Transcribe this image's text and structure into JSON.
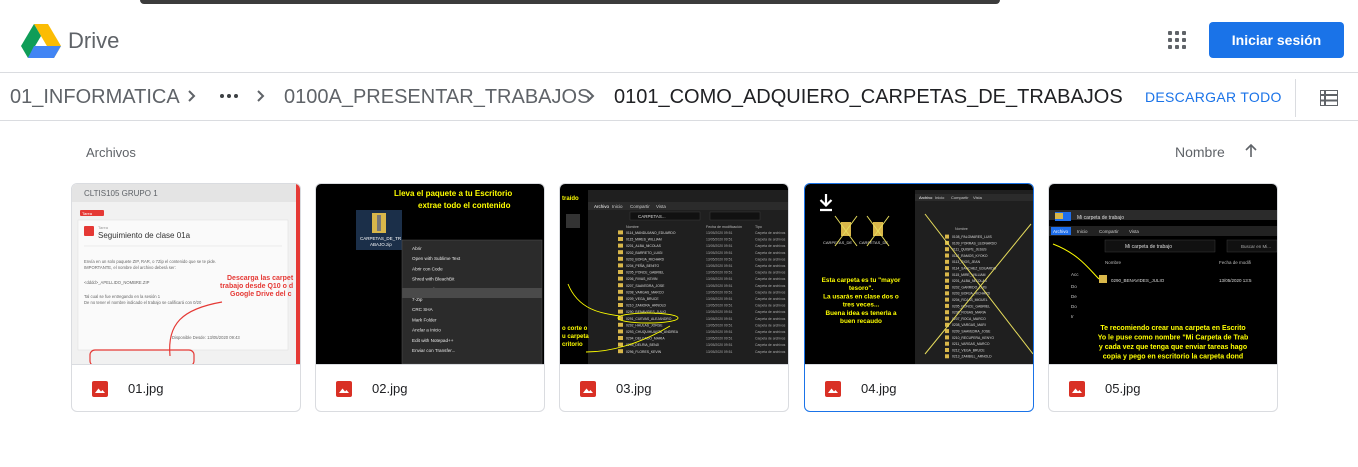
{
  "app": {
    "name": "Drive",
    "signin_label": "Iniciar sesión"
  },
  "breadcrumb": {
    "items": [
      "01_INFORMATICA",
      "0100A_PRESENTAR_TRABAJOS",
      "0101_COMO_ADQUIERO_CARPETAS_DE_TRABAJOS"
    ],
    "download_all": "DESCARGAR TODO"
  },
  "files_section": {
    "label": "Archivos",
    "sort_label": "Nombre"
  },
  "colors": {
    "accent": "#1a73e8",
    "image_icon": "#d93025",
    "annotation_yellow": "#ffff00",
    "annotation_red": "#ff0000"
  },
  "files": [
    {
      "name": "01.jpg",
      "selected": false,
      "thumb": {
        "group": "CLTIS105 GRUPO 1",
        "tag": "Tarea",
        "kind": "Tarea",
        "title": "Seguimiento de clase 01a",
        "body1": "Envía en un solo paquete ZIP, RAR, o 7Zip el contenido que se te pide.",
        "body2": "IMPORTANTE, el nombre del archivo deberá ser:",
        "body3": "<dddd>_APELLIDO_NOMBRE.ZIP",
        "body4": "Tal cual se fue entregando en la sesión 1",
        "body5": "De no tener el nombre indicado el trabajo se calificará con 0/20",
        "available": "Disponible Desde:  13/05/2020 09:43",
        "note1": "Descarga las carpet",
        "note2": "trabajo desde Q10 o d",
        "note3": "Google Drive del c"
      }
    },
    {
      "name": "02.jpg",
      "selected": false,
      "thumb": {
        "line1": "Lleva el paquete a tu Escritorio",
        "line2": "extrae todo el contenido",
        "file_label1": "CARPETAS_DE_TR",
        "file_label2": "ABAJO.zip",
        "menu": [
          "Abrir",
          "Open with Sublime Text",
          "Abrir con Code",
          "Shred with BleachBit",
          "Extraer todo...",
          "7-Zip",
          "CRC SHA",
          "Mark Folder",
          "Anclar a Inicio",
          "Edit with Notepad++",
          "Enviar con Transfer..."
        ]
      }
    },
    {
      "name": "03.jpg",
      "selected": false,
      "thumb": {
        "tabs": [
          "Archivo",
          "Inicio",
          "Compartir",
          "Vista"
        ],
        "path": "CARPETAS...",
        "col_name": "Nombre",
        "col_date": "Fecha de modificación",
        "col_type": "Tipo",
        "left_note": "traído",
        "bottom_note1": "o corte o",
        "bottom_note2": "u carpeta",
        "bottom_note3": "critorio",
        "rows": [
          "0114_MANDUJANO_EDUARDO",
          "0115_MIRES_WILLIAM",
          "0201_ALBA_NICOLAS",
          "0202_BARRETO_LUIGI",
          "0203_BORJA_RICHARD",
          "0204_PEÑA_BENITO",
          "0205_PONCE_GABRIEL",
          "0206_RIVAS_KEVIN",
          "0207_SAAVEDRA_JOSE",
          "0208_VARGAS_MARCO",
          "0209_VEGA_BRUCE",
          "0210_ZAMORA_ARNOLD",
          "0290_BENAVIDES_JULIO",
          "0291_CUEVAS_ALEJANDRO",
          "0292_HAULAS_JORGE",
          "0293_CHUQUIHUAYTA_ANDREA",
          "0294_DELGADO_MARIA",
          "0295_DELRIA_BENJI",
          "0296_FLORES_KEVIN"
        ],
        "row_date": "13/05/2020 09:51",
        "row_type": "Carpeta de archivos"
      }
    },
    {
      "name": "04.jpg",
      "selected": true,
      "thumb": {
        "folder1": "CARPETAS_DE",
        "folder2": "CARPETAS_DE",
        "note": [
          "Esta carpeta es tu \"mayor",
          "tesoro\".",
          "La usarás en clase dos o",
          "tres veces...",
          "Buena idea es tenerla a",
          "buen recaudo"
        ],
        "tabs": [
          "Archivo",
          "Inicio",
          "Compartir",
          "Vista"
        ],
        "col_name": "Nombre",
        "rows": [
          "0108_PALOMARES_LUIS",
          "0109_PORRAS_LEONARDO",
          "0111_QUISPE_JESUS",
          "0112_RAMOS_KYOKO",
          "0113_RIOS_JEAN",
          "0114_SANCHEZ_EDUARDO",
          "0115_MIRE_WILLIAM",
          "0201_ALBA_NICOLAS",
          "0202_GARRIDO_LUIS",
          "0203_BORJA_RICHARD",
          "0204_ROJAS_MIGUEL",
          "0205_PONCE_GABRIEL",
          "0206_ROSAS_MARIA",
          "0207_ROCA_MARCO",
          "0208_VARGAS_MARI",
          "0209_SAAVEDRA_JOSE",
          "0210_RECUPERA_KENYO",
          "0211_VARGAS_MARCO",
          "0212_VEGA_BRUCE",
          "0213_ZAMBILL_ARNOLD"
        ]
      }
    },
    {
      "name": "05.jpg",
      "selected": false,
      "thumb": {
        "window_title": "Mi carpeta de trabajo",
        "tabs": [
          "Archivo",
          "Inicio",
          "Compartir",
          "Vista"
        ],
        "path": "Mi carpeta de trabajo",
        "search": "Buscar en Mi...",
        "col_name": "Nombre",
        "col_date": "Fecha de modifi",
        "row_name": "0290_BENAVIDES_JULIO",
        "row_date": "13/05/2020 13:5",
        "side": [
          "Acc",
          "Do",
          "De",
          "Do",
          "Ir"
        ],
        "note": [
          "Te recomiendo crear una carpeta en Escrito",
          "Yo le puse como nombre \"Mi Carpeta de Trab",
          "y cada vez que tenga que enviar tareas hago",
          "copia y pego en escritorio la carpeta dond"
        ]
      }
    }
  ]
}
